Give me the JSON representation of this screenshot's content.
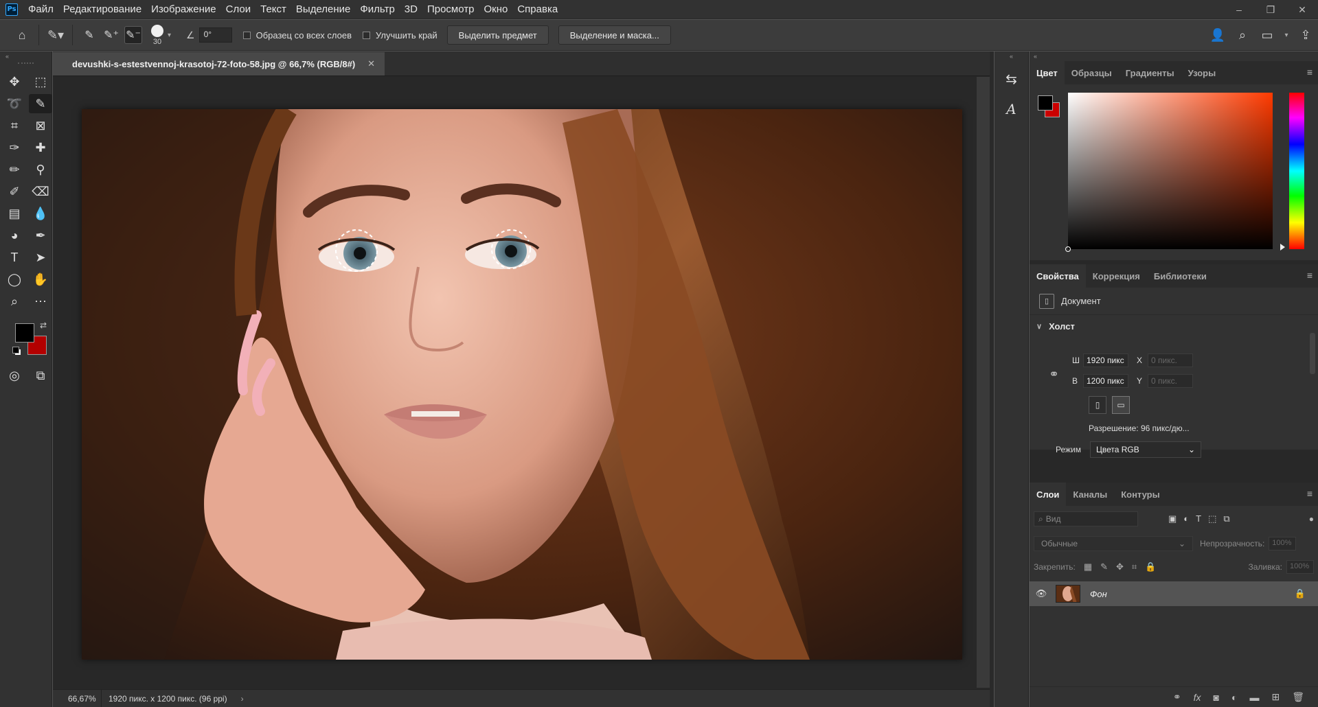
{
  "app": {
    "logo": "Ps"
  },
  "menu": [
    "Файл",
    "Редактирование",
    "Изображение",
    "Слои",
    "Текст",
    "Выделение",
    "Фильтр",
    "3D",
    "Просмотр",
    "Окно",
    "Справка"
  ],
  "window_controls": {
    "minimize": "–",
    "restore": "❐",
    "close": "✕"
  },
  "options": {
    "brush_size": "30",
    "angle": "0°",
    "sample_all_layers": "Образец со всех слоев",
    "enhance_edge": "Улучшить край",
    "select_subject": "Выделить предмет",
    "select_and_mask": "Выделение и маска..."
  },
  "document": {
    "tab_title": "devushki-s-estestvennoj-krasotoj-72-foto-58.jpg @ 66,7% (RGB/8#)",
    "close": "✕",
    "zoom": "66,67%",
    "status": "1920 пикс. x 1200 пикс. (96 ppi)",
    "status_arrow": "›"
  },
  "color_panel": {
    "tabs": [
      "Цвет",
      "Образцы",
      "Градиенты",
      "Узоры"
    ],
    "foreground": "#000000",
    "background": "#c00000"
  },
  "properties": {
    "tabs": [
      "Свойства",
      "Коррекция",
      "Библиотеки"
    ],
    "doc_label": "Документ",
    "canvas_label": "Холст",
    "width_label": "Ш",
    "width_value": "1920 пикс",
    "height_label": "В",
    "height_value": "1200 пикс",
    "x_label": "X",
    "x_placeholder": "0 пикс.",
    "y_label": "Y",
    "y_placeholder": "0 пикс.",
    "resolution": "Разрешение: 96 пикс/дю...",
    "mode_label": "Режим",
    "mode_value": "Цвета RGB"
  },
  "layers": {
    "tabs": [
      "Слои",
      "Каналы",
      "Контуры"
    ],
    "search_placeholder": "Вид",
    "blend_mode": "Обычные",
    "opacity_label": "Непрозрачность:",
    "opacity_value": "100%",
    "lock_label": "Закрепить:",
    "fill_label": "Заливка:",
    "fill_value": "100%",
    "items": [
      {
        "name": "Фон",
        "visible": true,
        "locked": true
      }
    ]
  },
  "mini_panel": {
    "header": "«"
  },
  "right_header": "«",
  "toolbar_header": "«"
}
